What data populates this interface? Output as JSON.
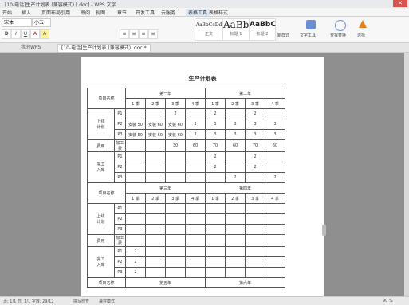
{
  "window": {
    "title": "[10-电话]生产计划表 (兼容模式) [.doc] - WPS 文字",
    "close_label": "✕"
  },
  "menu": {
    "items": [
      "开始",
      "插入",
      "页面布局",
      "引用",
      "审阅",
      "视图",
      "章节",
      "开发工具",
      "云服务",
      "表格工具",
      "表格样式"
    ],
    "active": 9
  },
  "toolbar": {
    "font_name": "宋体",
    "font_size": "小五",
    "styles": [
      {
        "sample": "AaBbCcDd",
        "label": "正文"
      },
      {
        "sample": "AaBb",
        "label": "标题 1"
      },
      {
        "sample": "AaBbC",
        "label": "标题 2"
      }
    ],
    "new_style_label": "新样式",
    "text_tools_label": "文字工具",
    "find_replace_label": "查找替换",
    "select_label": "选择"
  },
  "tabs": [
    {
      "label": "我的WPS",
      "current": false
    },
    {
      "label": "[10-电话]生产计划表 (兼容模式) .doc *",
      "current": true
    }
  ],
  "document": {
    "title": "生产计划表",
    "row_header": "项目名称",
    "years": [
      "第一年",
      "第二年",
      "第三年",
      "第四年",
      "第五年",
      "第六年"
    ],
    "quarters": [
      "1 季",
      "2 季",
      "3 季",
      "4 季"
    ],
    "groups": {
      "plan": "上线\n计划",
      "cost": "费用",
      "cost_item": "加工费",
      "done": "完工\n入库"
    },
    "products": [
      "P1",
      "P2",
      "P3"
    ],
    "block1": {
      "plan": [
        [
          "",
          "",
          "2",
          "",
          "2",
          "",
          "2",
          ""
        ],
        [
          "安装 50",
          "安装 60",
          "安装 60",
          "3",
          "3",
          "3",
          "3",
          "3"
        ],
        [
          "安装 50",
          "安装 60",
          "安装 60",
          "3",
          "3",
          "3",
          "3",
          "3"
        ]
      ],
      "cost": [
        "",
        "",
        "30",
        "60",
        "70",
        "60",
        "70",
        "60"
      ],
      "done": [
        [
          "",
          "",
          "",
          "",
          "2",
          "",
          "2",
          ""
        ],
        [
          "",
          "",
          "",
          "",
          "2",
          "",
          "2",
          ""
        ],
        [
          "",
          "",
          "",
          "",
          "",
          "2",
          "",
          "2"
        ]
      ]
    },
    "block2": {
      "plan": [
        [
          "",
          "",
          "",
          "",
          "",
          "",
          "",
          ""
        ],
        [
          "",
          "",
          "",
          "",
          "",
          "",
          "",
          ""
        ],
        [
          "",
          "",
          "",
          "",
          "",
          "",
          "",
          ""
        ]
      ],
      "cost": [
        "",
        "",
        "",
        "",
        "",
        "",
        "",
        ""
      ],
      "done": [
        [
          "2",
          "",
          "",
          "",
          "",
          "",
          "",
          ""
        ],
        [
          "2",
          "",
          "",
          "",
          "",
          "",
          "",
          ""
        ],
        [
          "2",
          "",
          "",
          "",
          "",
          "",
          "",
          ""
        ]
      ]
    }
  },
  "status": {
    "left": "页: 1/1  节: 1/1  字数: 29/12",
    "mid": "拼写检查",
    "mode": "兼容模式",
    "zoom": "90 %"
  }
}
